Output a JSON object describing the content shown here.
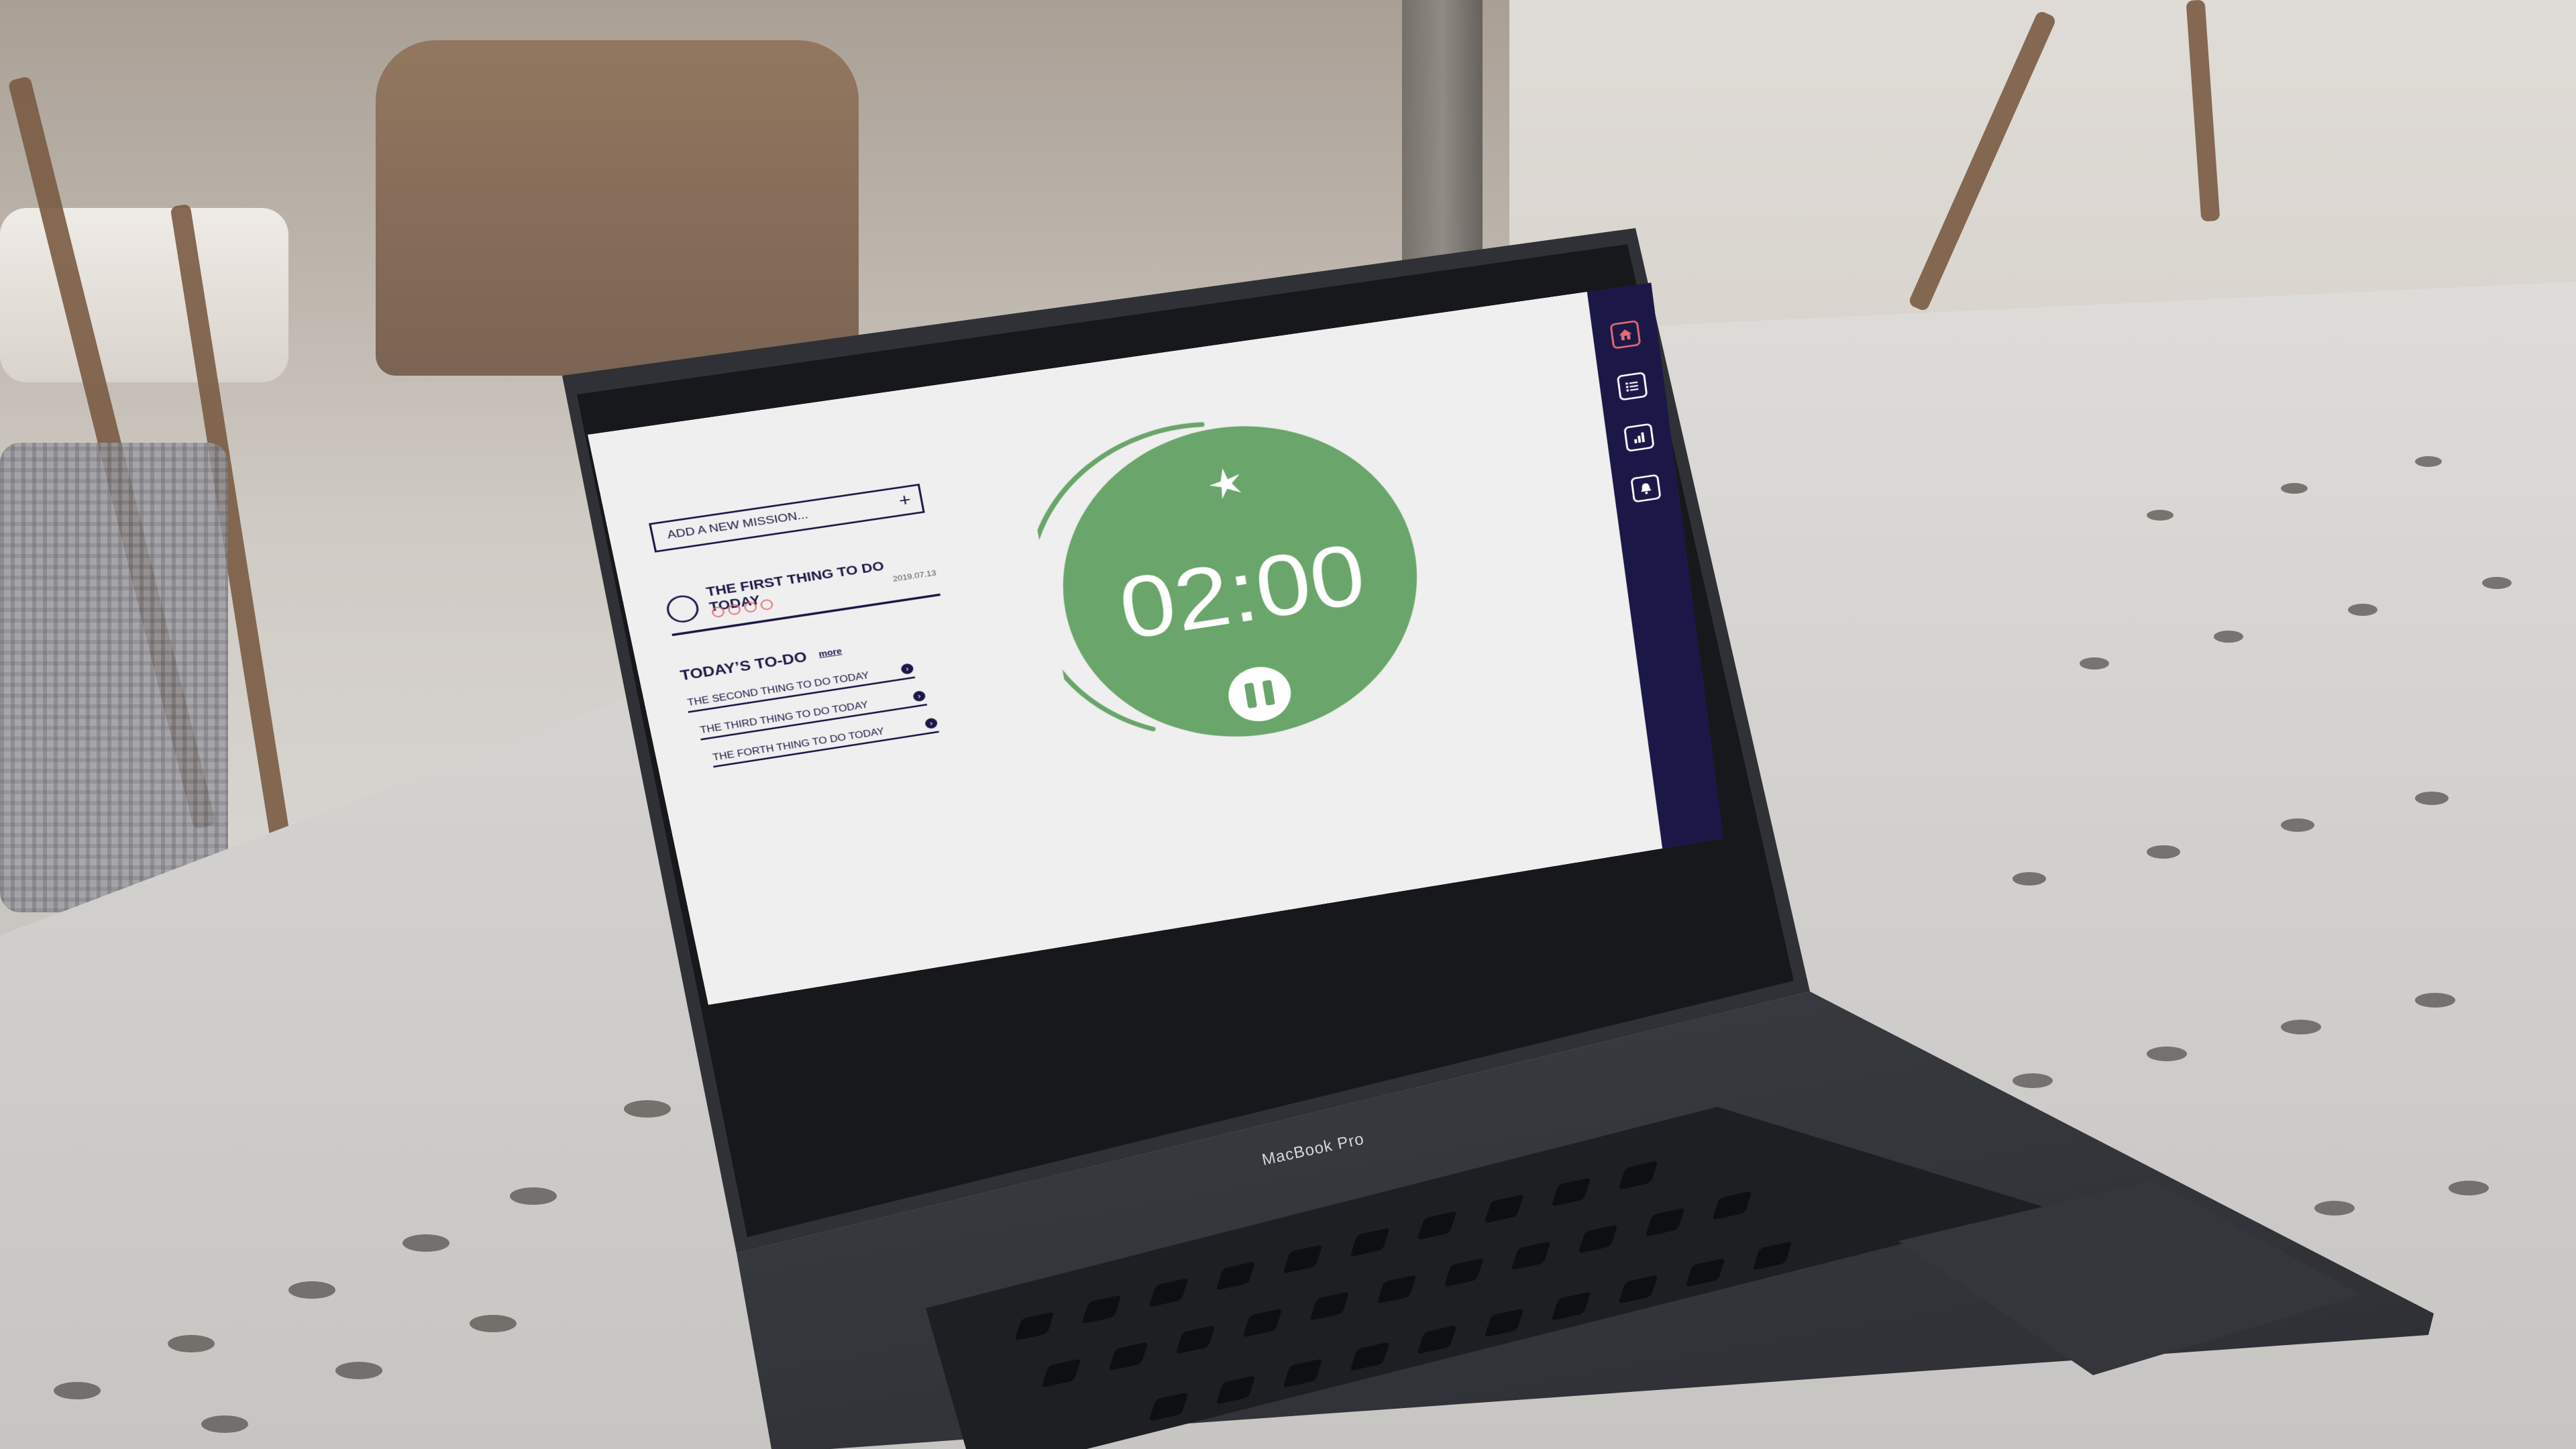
{
  "device": {
    "brand_label": "MacBook Pro"
  },
  "app": {
    "add_mission": {
      "placeholder": "ADD A NEW MISSION...",
      "add_label": "+"
    },
    "first_task": {
      "title": "THE FIRST THING TO DO TODAY",
      "date": "2019.07.13",
      "rating_dots": 4
    },
    "todo": {
      "title": "TODAY’S  TO-DO",
      "more_label": "more",
      "items": [
        {
          "label": "THE SECOND THING TO DO TODAY"
        },
        {
          "label": "THE THIRD THING TO DO TODAY"
        },
        {
          "label": "THE FORTH THING TO DO TODAY"
        }
      ]
    },
    "timer": {
      "time": "02:00",
      "state": "running",
      "icon": "leaf-icon"
    },
    "sidebar": {
      "items": [
        {
          "name": "home",
          "icon": "home-icon",
          "active": true
        },
        {
          "name": "list",
          "icon": "list-icon",
          "active": false
        },
        {
          "name": "stats",
          "icon": "bar-chart-icon",
          "active": false
        },
        {
          "name": "notifications",
          "icon": "bell-icon",
          "active": false
        }
      ]
    },
    "colors": {
      "navy": "#1b1848",
      "green": "#6aa56b",
      "accent": "#e86a72",
      "background": "#efefef"
    }
  }
}
